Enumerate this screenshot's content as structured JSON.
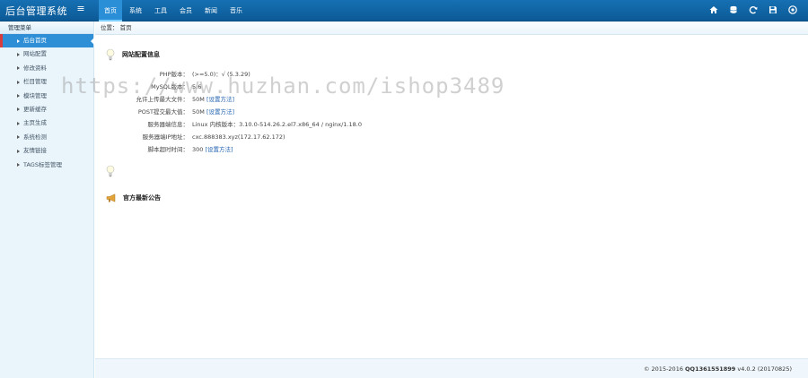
{
  "header": {
    "logo": "后台管理系统",
    "toggle_icon": "≡",
    "nav": [
      "首页",
      "系统",
      "工具",
      "会员",
      "新闻",
      "音乐"
    ],
    "tools": [
      "home-icon",
      "database-icon",
      "refresh-icon",
      "save-icon",
      "logout-icon"
    ]
  },
  "sidebar": {
    "title": "管理菜单",
    "items": [
      "后台首页",
      "网站配置",
      "修改资料",
      "栏目管理",
      "模块管理",
      "更新缓存",
      "主页生成",
      "系统检测",
      "友情链接",
      "TAGS标签管理"
    ]
  },
  "breadcrumb": {
    "label": "位置：",
    "current": "首页"
  },
  "config": {
    "title": "网站配置信息",
    "rows": [
      {
        "k": "PHP版本：",
        "v": "(>=5.0)：√  (5.3.29)",
        "link": ""
      },
      {
        "k": "MySQL版本：",
        "v": "5.6",
        "link": ""
      },
      {
        "k": "允许上传最大文件：",
        "v": "50M ",
        "link": "[设置方法]"
      },
      {
        "k": "POST提交最大值：",
        "v": "50M ",
        "link": "[设置方法]"
      },
      {
        "k": "服务器端信息：",
        "v": "Linux 内核版本：3.10.0-514.26.2.el7.x86_64 / nginx/1.18.0",
        "link": ""
      },
      {
        "k": "服务器端IP地址：",
        "v": "cxc.888383.xyz(172.17.62.172)",
        "link": ""
      },
      {
        "k": "脚本超时时间：",
        "v": "300 ",
        "link": "[设置方法]"
      }
    ]
  },
  "notice": {
    "title": "官方最新公告"
  },
  "watermark": "https://www.huzhan.com/ishop3489",
  "footer": {
    "copyright": "© 2015-2016 ",
    "qq": "QQ1361551899",
    "version": " v4.0.2 (20170825)"
  },
  "colors": {
    "topbar": "#1670b3",
    "active": "#2f8fd6",
    "accent_red": "#d93c3c",
    "link": "#2162b0"
  }
}
